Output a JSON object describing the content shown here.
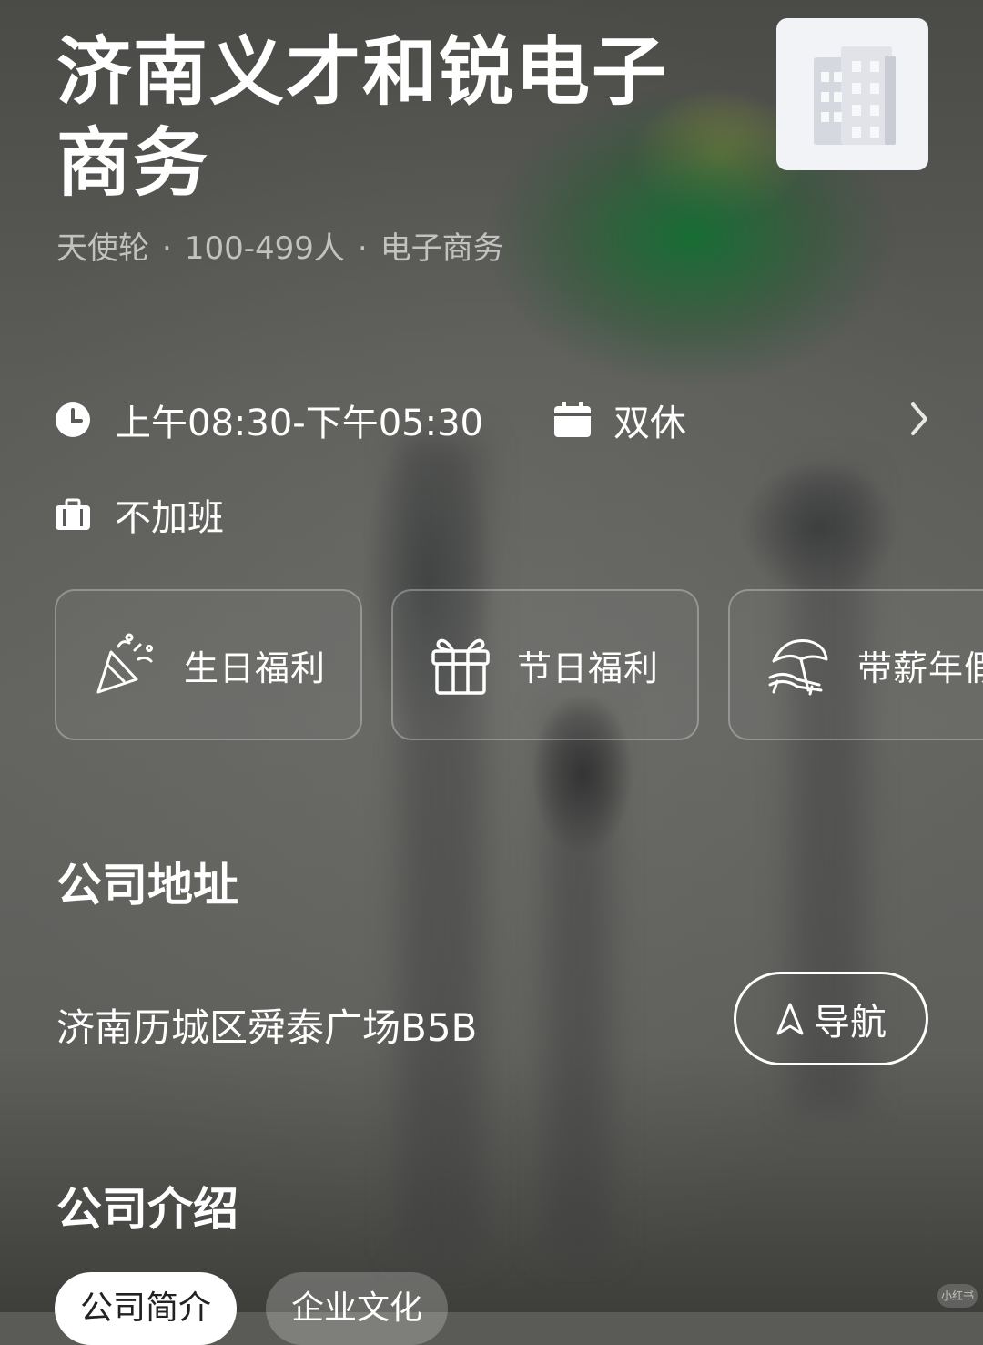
{
  "company": {
    "name": "济南义才和锐电子商务",
    "funding": "天使轮",
    "size": "100-499人",
    "industry": "电子商务"
  },
  "schedule": {
    "hours": "上午08:30-下午05:30",
    "rest": "双休",
    "overtime": "不加班"
  },
  "perks": [
    {
      "label": "生日福利",
      "icon": "party-popper-icon"
    },
    {
      "label": "节日福利",
      "icon": "gift-icon"
    },
    {
      "label": "带薪年假",
      "icon": "beach-chair-icon"
    }
  ],
  "address_section": {
    "title": "公司地址",
    "address": "济南历城区舜泰广场B5B",
    "nav_label": "导航"
  },
  "intro_section": {
    "title": "公司介绍",
    "tabs": [
      "公司简介",
      "企业文化"
    ]
  },
  "watermark": "小红书",
  "colors": {
    "text": "#ffffff",
    "subtext": "#e6e6e4",
    "logo_bg": "#f2f3f7",
    "active_tab_bg": "#ffffff",
    "active_tab_text": "#222222"
  }
}
